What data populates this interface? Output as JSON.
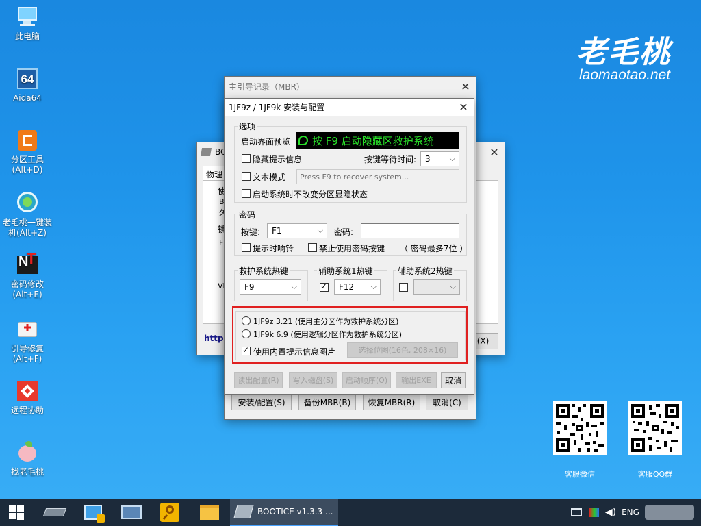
{
  "desktop": {
    "icons": [
      {
        "label": "此电脑",
        "icon": "this-pc-icon"
      },
      {
        "label": "Aida64",
        "icon": "aida64-icon"
      },
      {
        "label": "分区工具\n(Alt+D)",
        "icon": "partition-tool-icon"
      },
      {
        "label": "老毛桃一键装\n机(Alt+Z)",
        "icon": "one-click-install-icon"
      },
      {
        "label": "密码修改\n(Alt+E)",
        "icon": "password-change-icon"
      },
      {
        "label": "引导修复\n(Alt+F)",
        "icon": "boot-repair-icon"
      },
      {
        "label": "远程协助",
        "icon": "remote-assist-icon"
      },
      {
        "label": "找老毛桃",
        "icon": "find-laomaotao-icon"
      }
    ],
    "brand_cn": "老毛桃",
    "brand_en": "laomaotao.net",
    "qr": [
      {
        "caption": "客服微信"
      },
      {
        "caption": "客服QQ群"
      }
    ]
  },
  "bootice_window": {
    "title": "BOO",
    "tab": "物理",
    "fragments": [
      "使",
      "B",
      "久",
      "镜",
      "F",
      "VH",
      "http:"
    ],
    "right_button": "(X)"
  },
  "mbr_window": {
    "title": "主引导记录（MBR）",
    "buttons": {
      "install": "安装/配置(S)",
      "backup": "备份MBR(B)",
      "restore": "恢复MBR(R)",
      "cancel": "取消(C)"
    }
  },
  "config_dialog": {
    "title": "1JF9z / 1JF9k 安装与配置",
    "options": {
      "group": "选项",
      "preview_label": "启动界面预览",
      "preview_text": "按 F9 启动隐藏区救护系统",
      "hide_prompt": "隐藏提示信息",
      "wait_label": "按键等待时间:",
      "wait_value": "3",
      "text_mode": "文本模式",
      "text_mode_placeholder": "Press F9 to recover system...",
      "keep_partition": "启动系统时不改变分区显隐状态"
    },
    "password": {
      "group": "密码",
      "key_label": "按键:",
      "key_value": "F1",
      "pwd_label": "密码:",
      "pwd_value": "",
      "beep": "提示时响铃",
      "disable_key": "禁止使用密码按键",
      "max_note": "（ 密码最多7位 ）"
    },
    "hotkeys": {
      "rescue_group": "救护系统热键",
      "rescue_value": "F9",
      "aux1_group": "辅助系统1热键",
      "aux1_value": "F12",
      "aux1_checked": true,
      "aux2_group": "辅助系统2热键",
      "aux2_value": "",
      "aux2_checked": false
    },
    "version": {
      "radio1": "1JF9z 3.21 (使用主分区作为救护系统分区)",
      "radio2": "1JF9k 6.9 (使用逻辑分区作为救护系统分区)",
      "builtin_image": "使用内置提示信息图片",
      "builtin_checked": true,
      "select_bitmap": "选择位图(16色, 208×16)",
      "highlight_color": "#e02020"
    },
    "bottom_buttons": {
      "read": "读出配置(R)",
      "write": "写入磁盘(S)",
      "order": "启动顺序(O)",
      "export": "输出EXE",
      "cancel": "取消"
    }
  },
  "taskbar": {
    "active_app": "BOOTICE v1.3.3 ...",
    "lang": "ENG",
    "colors": {
      "bg": "#1c2a3a",
      "accent": "#4aa3ff"
    }
  }
}
